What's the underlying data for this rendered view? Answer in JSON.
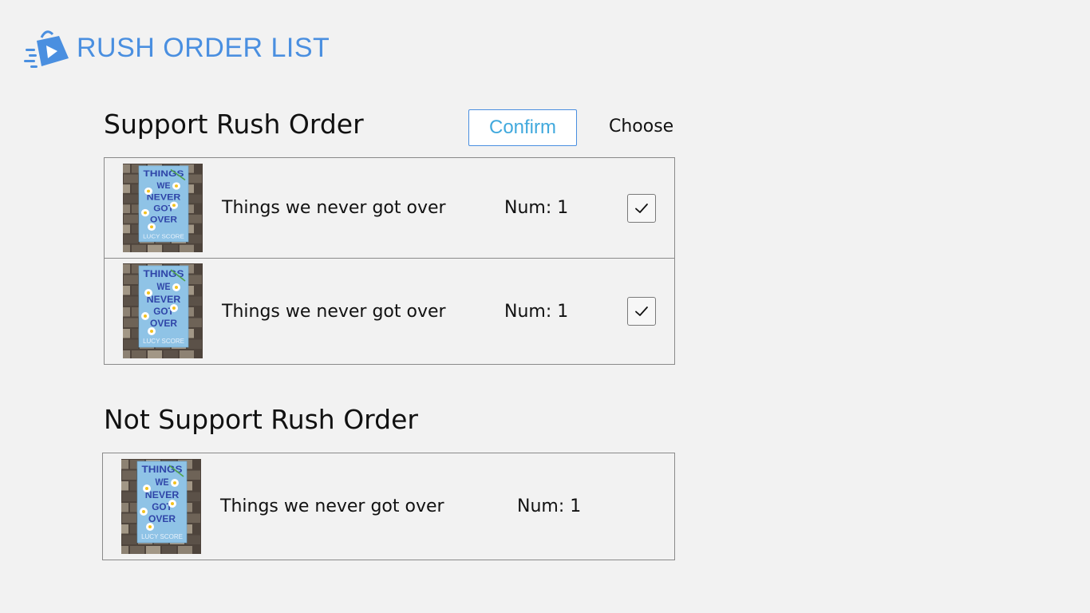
{
  "app": {
    "title": "RUSH ORDER LIST",
    "logo_icon": "shopping-bag-play-icon",
    "accent_color": "#4a8fe0"
  },
  "support_section": {
    "title": "Support Rush Order",
    "confirm_label": "Confirm",
    "choose_label": "Choose",
    "items": [
      {
        "name": "Things we never got over",
        "num": "Num: 1",
        "checked": true,
        "cover_icon": "book-cover-image"
      },
      {
        "name": "Things we never got over",
        "num": "Num: 1",
        "checked": true,
        "cover_icon": "book-cover-image"
      }
    ]
  },
  "not_support_section": {
    "title": "Not Support Rush Order",
    "items": [
      {
        "name": "Things we never got over",
        "num": "Num: 1",
        "cover_icon": "book-cover-image"
      }
    ]
  },
  "book_cover": {
    "title_words": [
      "THINGS",
      "WE",
      "NEVER",
      "GOT",
      "OVER"
    ],
    "author": "LUCY SCORE"
  }
}
